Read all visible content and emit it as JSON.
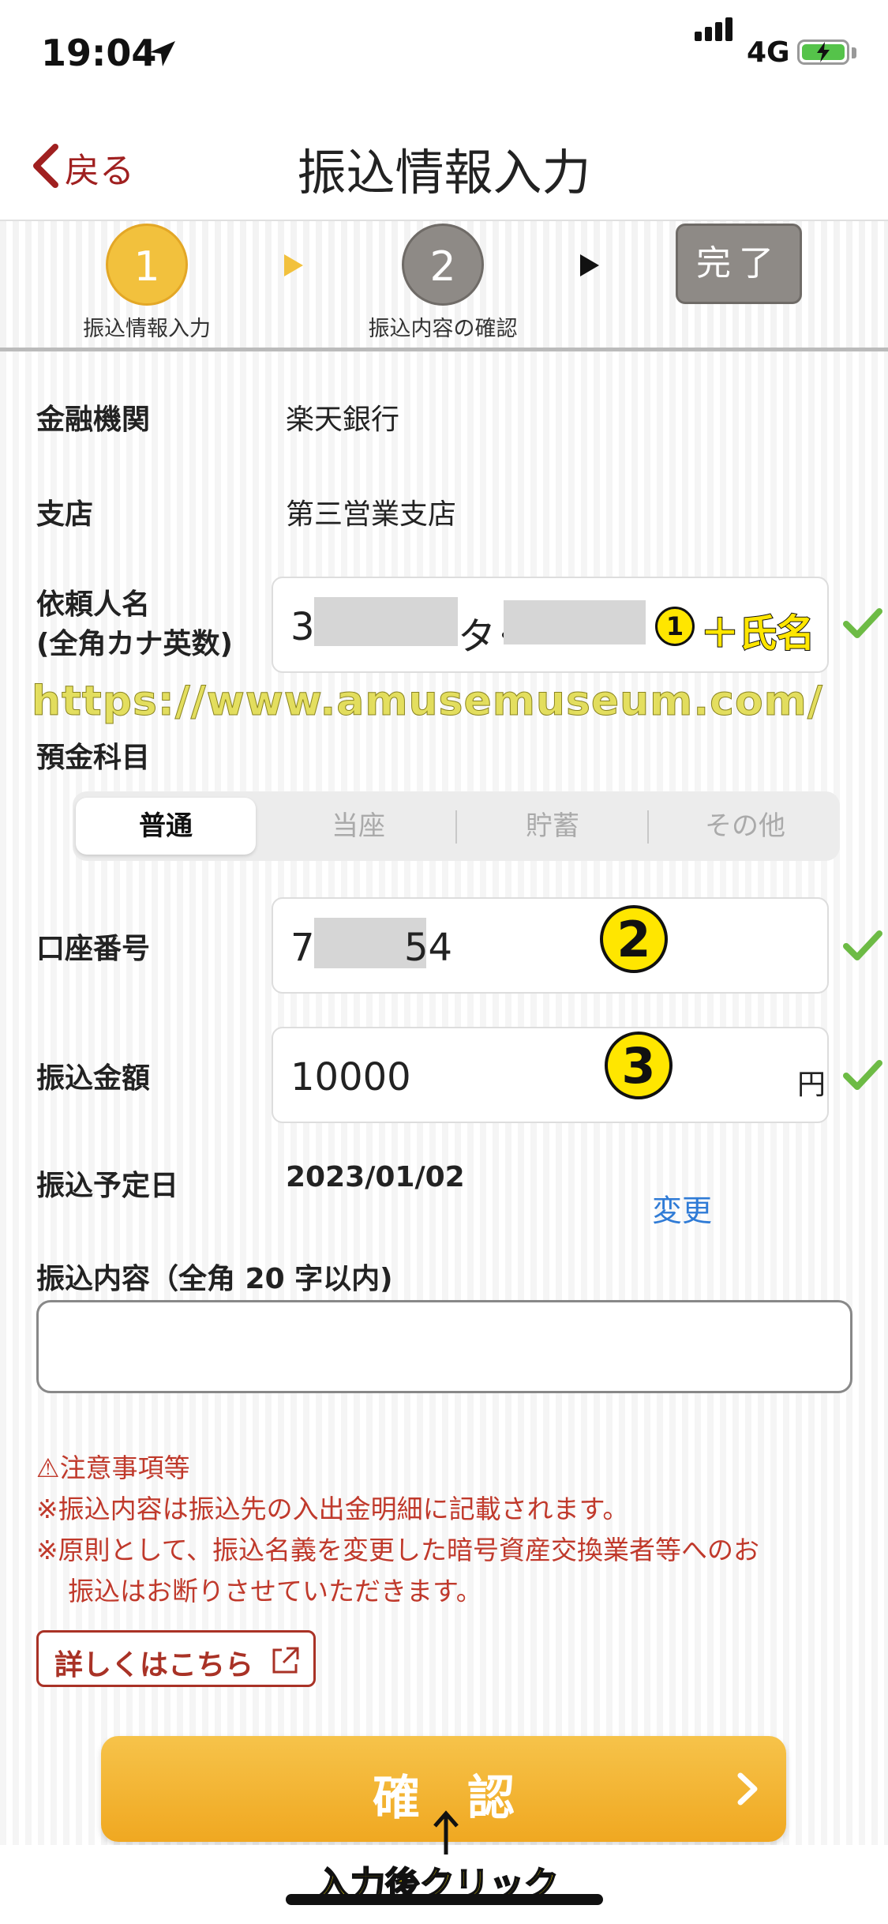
{
  "status_bar": {
    "time": "19:04",
    "network": "4G",
    "battery_level": 0.9
  },
  "nav": {
    "back_label": "戻る",
    "title": "振込情報入力"
  },
  "steps": [
    {
      "number": "1",
      "caption": "振込情報入力"
    },
    {
      "number": "2",
      "caption": "振込内容の確認"
    },
    {
      "label": "完了"
    }
  ],
  "form": {
    "bank": {
      "label": "金融機関",
      "value": "楽天銀行"
    },
    "branch": {
      "label": "支店",
      "value": "第三営業支店"
    },
    "requester": {
      "label_line1": "依頼人名",
      "label_line2": "(全角カナ英数)",
      "value_prefix": "3",
      "value_mid": "タ･"
    },
    "deposit_type": {
      "label": "預金科目",
      "options": [
        "普通",
        "当座",
        "貯蓄",
        "その他"
      ],
      "selected": "普通"
    },
    "account_number": {
      "label": "口座番号",
      "value_prefix": "7",
      "value_suffix": "54"
    },
    "amount": {
      "label": "振込金額",
      "value": "10000",
      "unit": "円"
    },
    "date": {
      "label": "振込予定日",
      "value": "2023/01/02",
      "change_link": "変更"
    },
    "memo": {
      "label": "振込内容（全角 20 字以内)",
      "value": ""
    }
  },
  "notice": {
    "title": "⚠注意事項等",
    "line1": "※振込内容は振込先の入出金明細に記載されます。",
    "line2": "※原則として、振込名義を変更した暗号資産交換業者等へのお",
    "line3": "振込はお断りさせていただきます。"
  },
  "detail_button": {
    "label": "詳しくはこちら"
  },
  "confirm_button": {
    "label": "確認"
  },
  "annotations": {
    "watermark": "https://www.amusemuseum.com/",
    "step1_number": "1",
    "step1_text": "＋氏名",
    "step2_number": "2",
    "step3_number": "3",
    "click_note": "入力後クリック"
  },
  "colors": {
    "accent_red": "#a02020",
    "step_active": "#f2c13d",
    "button_orange": "#f0a821",
    "link_blue": "#2f7bd6",
    "check_green": "#6dbb45"
  }
}
